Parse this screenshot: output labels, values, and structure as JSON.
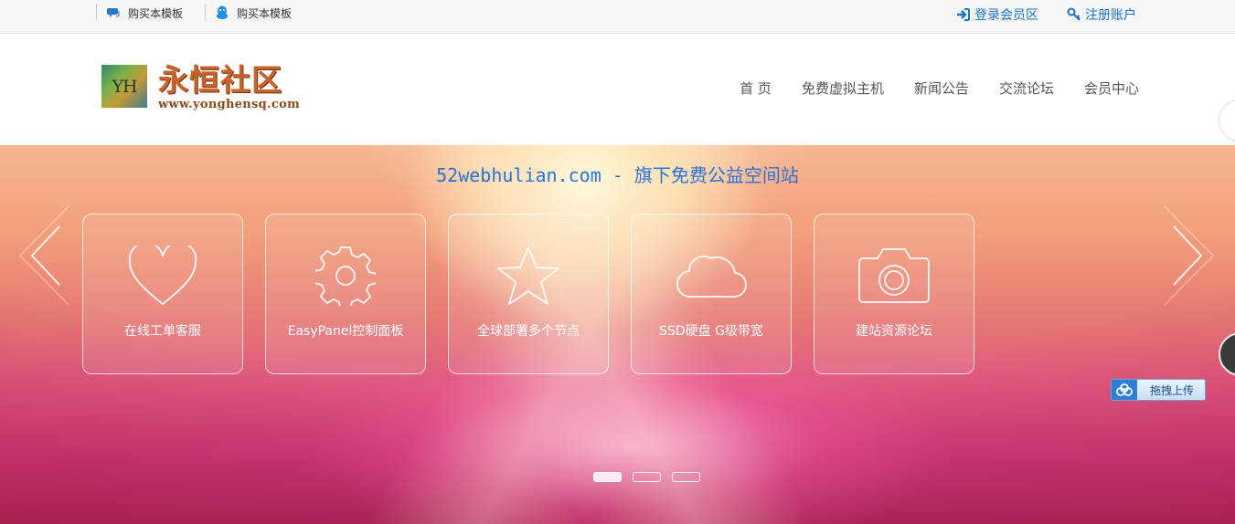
{
  "topbar": {
    "left_links": [
      {
        "label": "购买本模板",
        "icon": "chat-bubble-icon"
      },
      {
        "label": "购买本模板",
        "icon": "qq-penguin-icon"
      }
    ],
    "login_label": "登录会员区",
    "register_label": "注册账户"
  },
  "header": {
    "logo_mark": "YH",
    "logo_name": "永恒社区",
    "logo_url": "www.yonghensq.com",
    "nav": [
      "首 页",
      "免费虚拟主机",
      "新闻公告",
      "交流论坛",
      "会员中心"
    ]
  },
  "banner": {
    "title": "52webhulian.com - 旗下免费公益空间站",
    "features": [
      {
        "label": "在线工单客服",
        "icon": "heart-icon"
      },
      {
        "label": "EasyPanel控制面板",
        "icon": "gear-icon"
      },
      {
        "label": "全球部署多个节点",
        "icon": "star-icon"
      },
      {
        "label": "SSD硬盘 G级带宽",
        "icon": "cloud-icon"
      },
      {
        "label": "建站资源论坛",
        "icon": "camera-icon"
      }
    ],
    "slide_count": 3,
    "active_slide": 1
  },
  "upload_widget": {
    "label": "拖拽上传"
  },
  "colors": {
    "link_blue": "#1a73c8",
    "title_blue": "#2a72d8",
    "logo_orange": "#c8642a"
  }
}
